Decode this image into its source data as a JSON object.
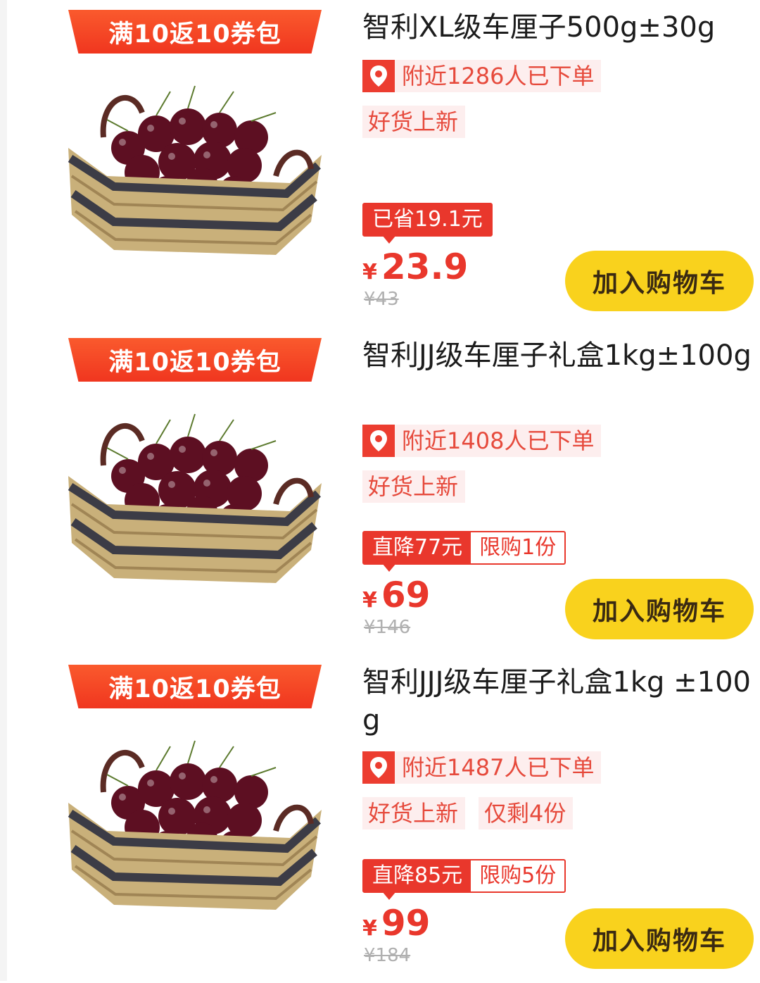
{
  "products": [
    {
      "coupon": "满10返10券包",
      "title": "智利XL级车厘子500g±30g",
      "nearby": "附近1286人已下单",
      "tags": [
        "好货上新"
      ],
      "promo": "已省19.1元",
      "limit": "",
      "currency": "¥",
      "price": "23.9",
      "original_price": "¥43",
      "cart_label": "加入购物车"
    },
    {
      "coupon": "满10返10券包",
      "title": "智利JJ级车厘子礼盒1kg±100g",
      "nearby": "附近1408人已下单",
      "tags": [
        "好货上新"
      ],
      "promo": "直降77元",
      "limit": "限购1份",
      "currency": "¥",
      "price": "69",
      "original_price": "¥146",
      "cart_label": "加入购物车"
    },
    {
      "coupon": "满10返10券包",
      "title": "智利JJJ级车厘子礼盒1kg ±100g",
      "nearby": "附近1487人已下单",
      "tags": [
        "好货上新",
        "仅剩4份"
      ],
      "promo": "直降85元",
      "limit": "限购5份",
      "currency": "¥",
      "price": "99",
      "original_price": "¥184",
      "cart_label": "加入购物车"
    }
  ],
  "icons": {
    "location": "location-pin-icon",
    "product_image": "cherry-basket-image"
  },
  "colors": {
    "accent_red": "#e9372c",
    "ribbon": "#f0361f",
    "cart_yellow": "#f9d21d",
    "tag_bg": "#fdeeee"
  }
}
